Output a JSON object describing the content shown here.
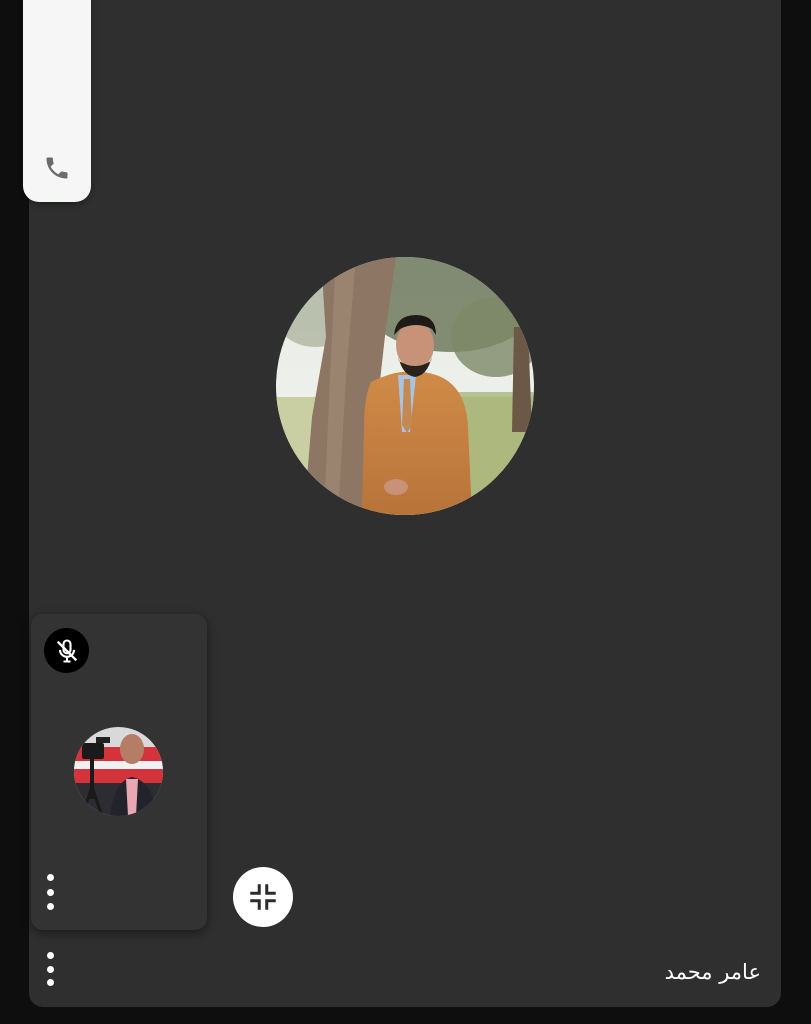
{
  "call": {
    "caller_name": "عامر محمد",
    "remote_participant_avatar": "person-under-tree-photo",
    "local_participant_avatar": "person-with-camera-photo",
    "local_muted": true
  },
  "icons": {
    "side_pill": "phone-icon",
    "mute_badge": "mic-off-icon",
    "collapse": "collapse-fullscreen-icon",
    "tile_menu": "more-vertical-icon",
    "panel_menu": "more-vertical-icon"
  },
  "colors": {
    "panel_background": "#2e2f2e",
    "tile_background": "#323332",
    "pill_background": "#f6f6f6",
    "icon_light": "#ffffff",
    "text": "#ffffff"
  }
}
